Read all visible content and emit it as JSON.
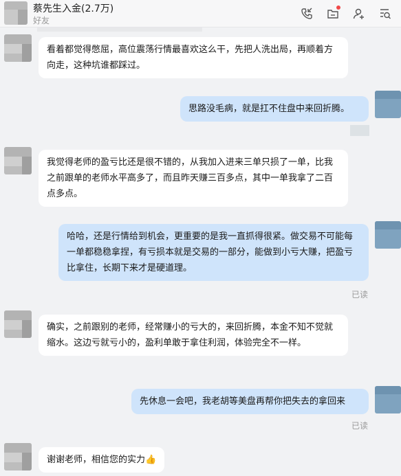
{
  "header": {
    "contact_name": "蔡先生入金(2.7万)",
    "contact_tag": "好友"
  },
  "icons": [
    "phone-icon",
    "folder-icon",
    "add-person-icon",
    "search-chat-icon"
  ],
  "messages": [
    {
      "side": "left",
      "text": "看着都觉得憋屈，高位震荡行情最喜欢这么干，先把人洗出局，再顺着方向走，这种坑谁都踩过。"
    },
    {
      "side": "right",
      "text": "思路没毛病，就是扛不住盘中来回折腾。"
    },
    {
      "side": "left",
      "text": "我觉得老师的盈亏比还是很不错的，从我加入进来三单只损了一单，比我之前跟单的老师水平高多了，而且昨天赚三百多点，其中一单我拿了二百点多点。"
    },
    {
      "side": "right",
      "text": "哈哈，还是行情给到机会，更重要的是我一直抓得很紧。做交易不可能每一单都稳稳拿捏，有亏损本就是交易的一部分，能做到小亏大赚，把盈亏比拿住，长期下来才是硬道理。",
      "status": "已读"
    },
    {
      "side": "left",
      "text": "确实，之前跟别的老师，经常赚小的亏大的，来回折腾，本金不知不觉就缩水。这边亏就亏小的，盈利单敢于拿住利润，体验完全不一样。"
    },
    {
      "side": "right",
      "text": "先休息一会吧，我老胡等美盘再帮你把失去的拿回来",
      "status": "已读"
    },
    {
      "side": "left",
      "text": "谢谢老师，相信您的实力👍"
    }
  ]
}
